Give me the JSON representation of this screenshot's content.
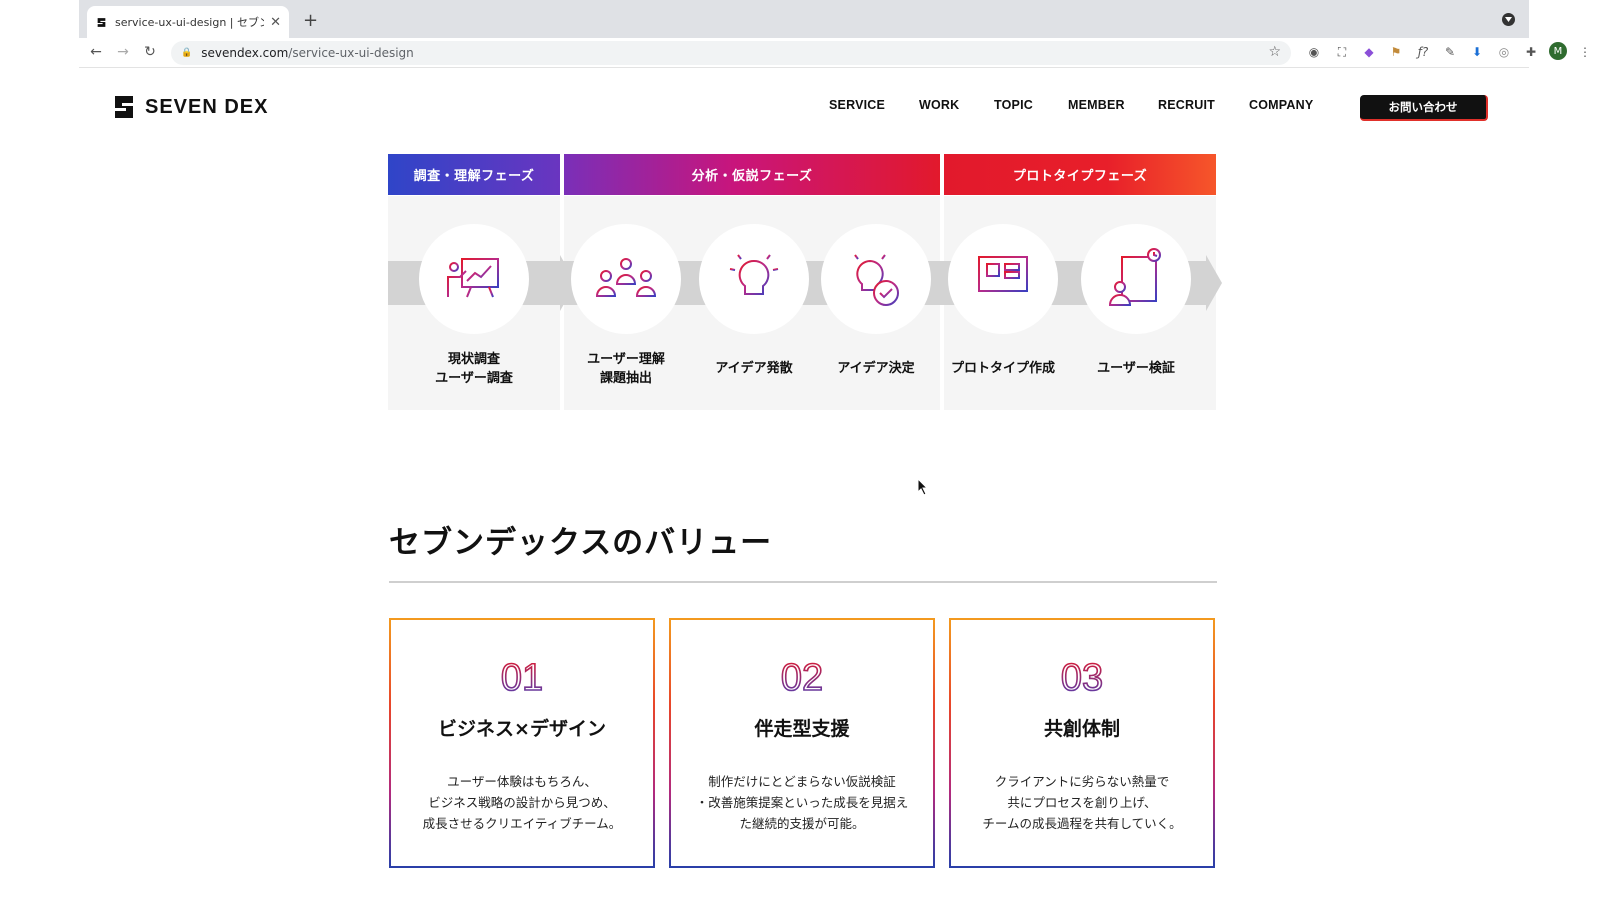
{
  "browser": {
    "tab_title": "service-ux-ui-design | セブンデ",
    "url_host": "sevendex.com",
    "url_path": "/service-ux-ui-design",
    "avatar_initial": "M"
  },
  "site": {
    "logo_text": "SEVEN DEX",
    "nav": [
      "SERVICE",
      "WORK",
      "TOPIC",
      "MEMBER",
      "RECRUIT",
      "COMPANY"
    ],
    "contact_label": "お問い合わせ"
  },
  "phases": {
    "headers": [
      "調査・理解フェーズ",
      "分析・仮説フェーズ",
      "プロトタイプフェーズ"
    ],
    "steps": [
      {
        "icon": "presentation-chart-icon",
        "lines": [
          "現状調査",
          "ユーザー調査"
        ]
      },
      {
        "icon": "users-group-icon",
        "lines": [
          "ユーザー理解",
          "課題抽出"
        ]
      },
      {
        "icon": "lightbulb-icon",
        "lines": [
          "アイデア発散"
        ]
      },
      {
        "icon": "lightbulb-check-icon",
        "lines": [
          "アイデア決定"
        ]
      },
      {
        "icon": "monitor-wireframe-icon",
        "lines": [
          "プロトタイプ作成"
        ]
      },
      {
        "icon": "user-test-icon",
        "lines": [
          "ユーザー検証"
        ]
      }
    ],
    "colors": {
      "gray": "#d3d3d3",
      "blue": "#2f45c8",
      "purple": "#8a2fb8",
      "red": "#e2192c",
      "orange": "#f0562a"
    }
  },
  "values": {
    "title": "セブンデックスのバリュー",
    "cards": [
      {
        "num": "01",
        "title": "ビジネス×デザイン",
        "lines": [
          "ユーザー体験はもちろん、",
          "ビジネス戦略の設計から見つめ、",
          "成長させるクリエイティブチーム。"
        ]
      },
      {
        "num": "02",
        "title": "伴走型支援",
        "lines": [
          "制作だけにとどまらない仮説検証",
          "・改善施策提案といった成長を見据え",
          "た継続的支援が可能。"
        ]
      },
      {
        "num": "03",
        "title": "共創体制",
        "lines": [
          "クライアントに劣らない熱量で",
          "共にプロセスを創り上げ、",
          "チームの成長過程を共有していく。"
        ]
      }
    ]
  }
}
